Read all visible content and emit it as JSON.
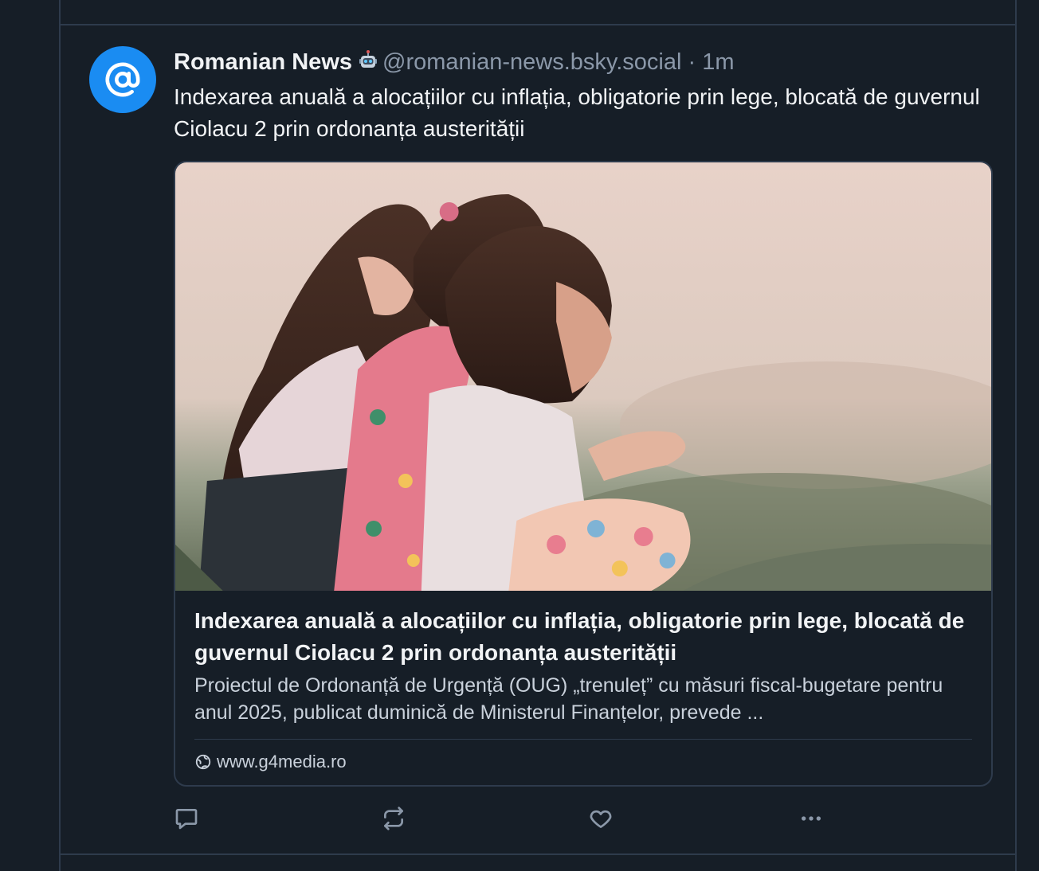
{
  "post": {
    "author_name": "Romanian News",
    "bot_badge_icon": "robot-icon",
    "handle": "@romanian-news.bsky.social",
    "separator": " · ",
    "timestamp": "1m",
    "text": "Indexarea anuală a alocațiilor cu inflația, obligatorie prin lege, blocată de guvernul Ciolacu 2 prin ordonanța austerității",
    "avatar_icon": "at-sign-icon",
    "avatar_color": "#1a8cf2"
  },
  "link_card": {
    "image_alt": "three-children-sitting-on-grass",
    "title": "Indexarea anuală a alocațiilor cu inflația, obligatorie prin lege, blocată de guvernul Ciolacu 2 prin ordonanța austerității",
    "description": "Proiectul de Ordonanță de Urgență (OUG) „trenuleț” cu măsuri fiscal-bugetare pentru anul 2025, publicat duminică de Ministerul Finanțelor, prevede ...",
    "domain_icon": "globe-icon",
    "domain": "www.g4media.ro"
  },
  "actions": [
    {
      "name": "reply",
      "icon": "speech-bubble-icon"
    },
    {
      "name": "repost",
      "icon": "repost-arrows-icon"
    },
    {
      "name": "like",
      "icon": "heart-icon"
    },
    {
      "name": "more",
      "icon": "ellipsis-icon"
    }
  ],
  "theme": {
    "background": "#161e27",
    "border": "#2e3b4c",
    "text_primary": "#f1f3f5",
    "text_secondary": "#8b98a9",
    "accent": "#1a8cf2"
  }
}
